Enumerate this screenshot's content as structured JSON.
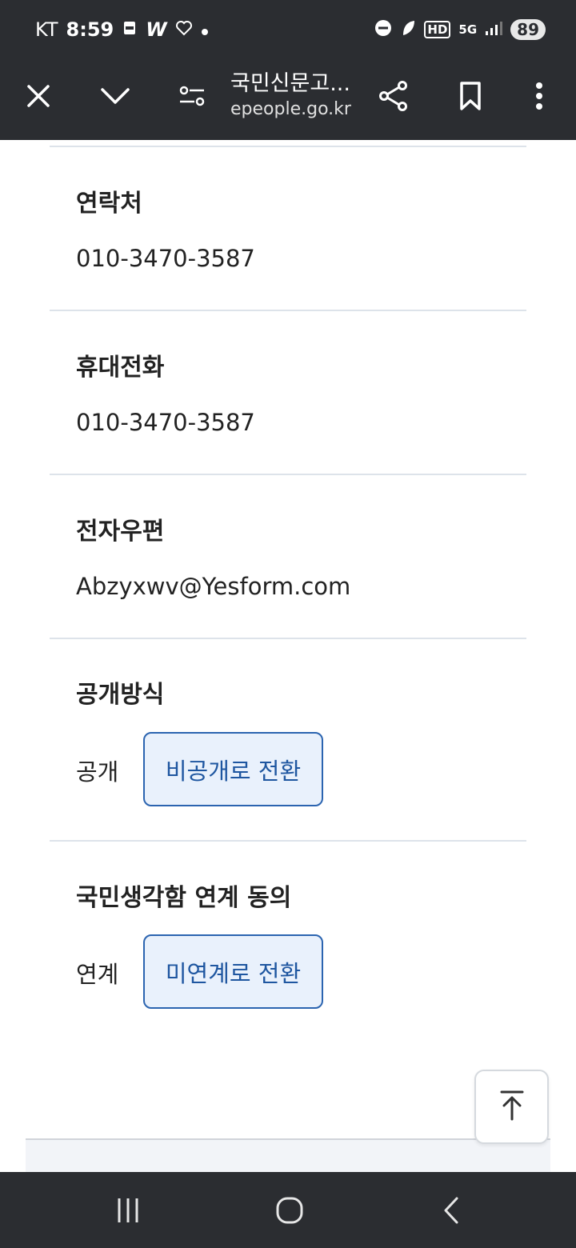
{
  "status_bar": {
    "carrier": "KT",
    "time": "8:59",
    "app_letter": "W",
    "network": "5G",
    "hd_badge": "HD",
    "battery": "89"
  },
  "toolbar": {
    "title": "국민신문고...",
    "url": "epeople.go.kr"
  },
  "fields": {
    "contact": {
      "label": "연락처",
      "value": "010-3470-3587"
    },
    "mobile": {
      "label": "휴대전화",
      "value": "010-3470-3587"
    },
    "email": {
      "label": "전자우편",
      "value": "Abzyxwv@Yesform.com"
    },
    "disclosure": {
      "label": "공개방식",
      "value": "공개",
      "button": "비공개로 전환"
    },
    "linkage": {
      "label": "국민생각함 연계 동의",
      "value": "연계",
      "button": "미연계로 전환"
    }
  },
  "colors": {
    "bar_background": "#2b2d31",
    "button_border": "#2b64b0",
    "button_fill": "#e9f1fc",
    "button_text": "#1e56a0"
  }
}
